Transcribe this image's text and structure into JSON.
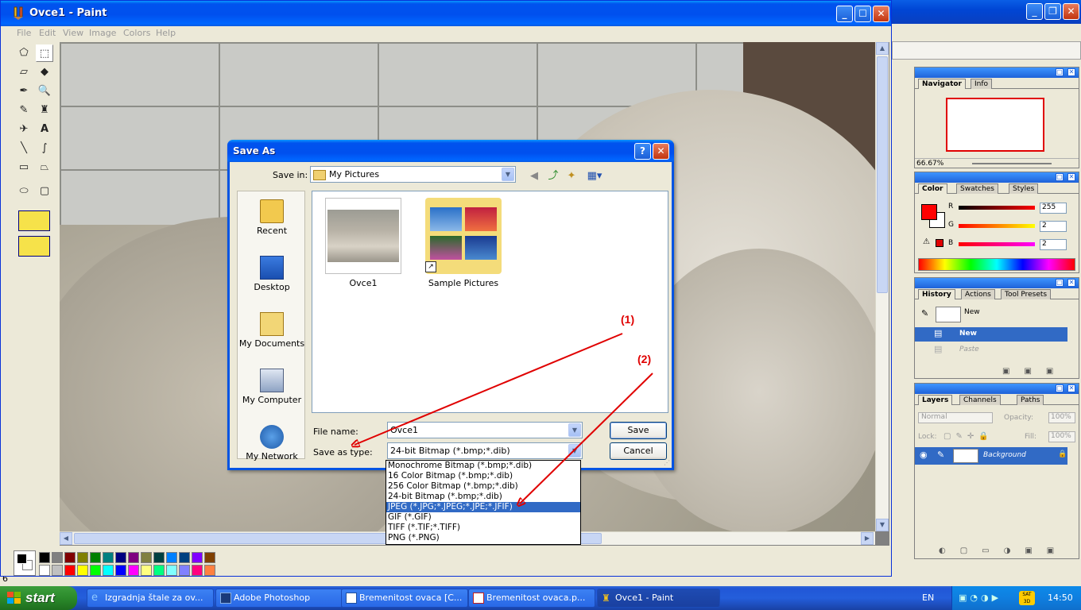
{
  "paint": {
    "title": "Ovce1 - Paint",
    "menu": [
      "File",
      "Edit",
      "View",
      "Image",
      "Colors",
      "Help"
    ],
    "palette_colors": [
      "#000000",
      "#808080",
      "#800000",
      "#808000",
      "#008000",
      "#008080",
      "#000080",
      "#800080",
      "#808040",
      "#004040",
      "#0080ff",
      "#004080",
      "#8000ff",
      "#804000",
      "#ffffff",
      "#c0c0c0",
      "#ff0000",
      "#ffff00",
      "#00ff00",
      "#00ffff",
      "#0000ff",
      "#ff00ff",
      "#ffff80",
      "#00ff80",
      "#80ffff",
      "#8080ff",
      "#ff0080",
      "#ff8040"
    ]
  },
  "dialog": {
    "title": "Save As",
    "save_in_label": "Save in:",
    "save_in_value": "My Pictures",
    "places": [
      "Recent",
      "Desktop",
      "My Documents",
      "My Computer",
      "My Network"
    ],
    "files": [
      "Ovce1",
      "Sample Pictures"
    ],
    "file_name_label": "File name:",
    "file_name_value": "Ovce1",
    "save_type_label": "Save as type:",
    "save_type_value": "24-bit Bitmap (*.bmp;*.dib)",
    "save_button": "Save",
    "cancel_button": "Cancel",
    "type_options": [
      "Monochrome Bitmap (*.bmp;*.dib)",
      "16 Color Bitmap (*.bmp;*.dib)",
      "256 Color Bitmap (*.bmp;*.dib)",
      "24-bit Bitmap (*.bmp;*.dib)",
      "JPEG (*.JPG;*.JPEG;*.JPE;*.JFIF)",
      "GIF (*.GIF)",
      "TIFF (*.TIF;*.TIFF)",
      "PNG (*.PNG)"
    ],
    "selected_type_index": 4
  },
  "annotations": {
    "label1": "(1)",
    "label2": "(2)",
    "color": "#e00000"
  },
  "photoshop": {
    "navigator": {
      "tabs": [
        "Navigator",
        "Info"
      ],
      "zoom": "66.67%"
    },
    "color": {
      "tabs": [
        "Color",
        "Swatches",
        "Styles"
      ],
      "r_label": "R",
      "g_label": "G",
      "b_label": "B",
      "r": "255",
      "g": "2",
      "b": "2",
      "fg": "#ff0000"
    },
    "history": {
      "tabs": [
        "History",
        "Actions",
        "Tool Presets"
      ],
      "snapshot": "New",
      "items": [
        "New",
        "Paste"
      ]
    },
    "layers": {
      "tabs": [
        "Layers",
        "Channels",
        "Paths"
      ],
      "blend": "Normal",
      "opacity_label": "Opacity:",
      "opacity": "100%",
      "lock_label": "Lock:",
      "fill_label": "Fill:",
      "fill": "100%",
      "layer_name": "Background"
    },
    "left_edge_digit": "6"
  },
  "taskbar": {
    "start": "start",
    "tasks": [
      "Izgradnja štale za ov...",
      "Adobe Photoshop",
      "Bremenitost ovaca [C...",
      "Bremenitost ovaca.p...",
      "Ovce1 - Paint"
    ],
    "language": "EN",
    "clock": "14:50",
    "tray_badge": "SAT 3D"
  }
}
